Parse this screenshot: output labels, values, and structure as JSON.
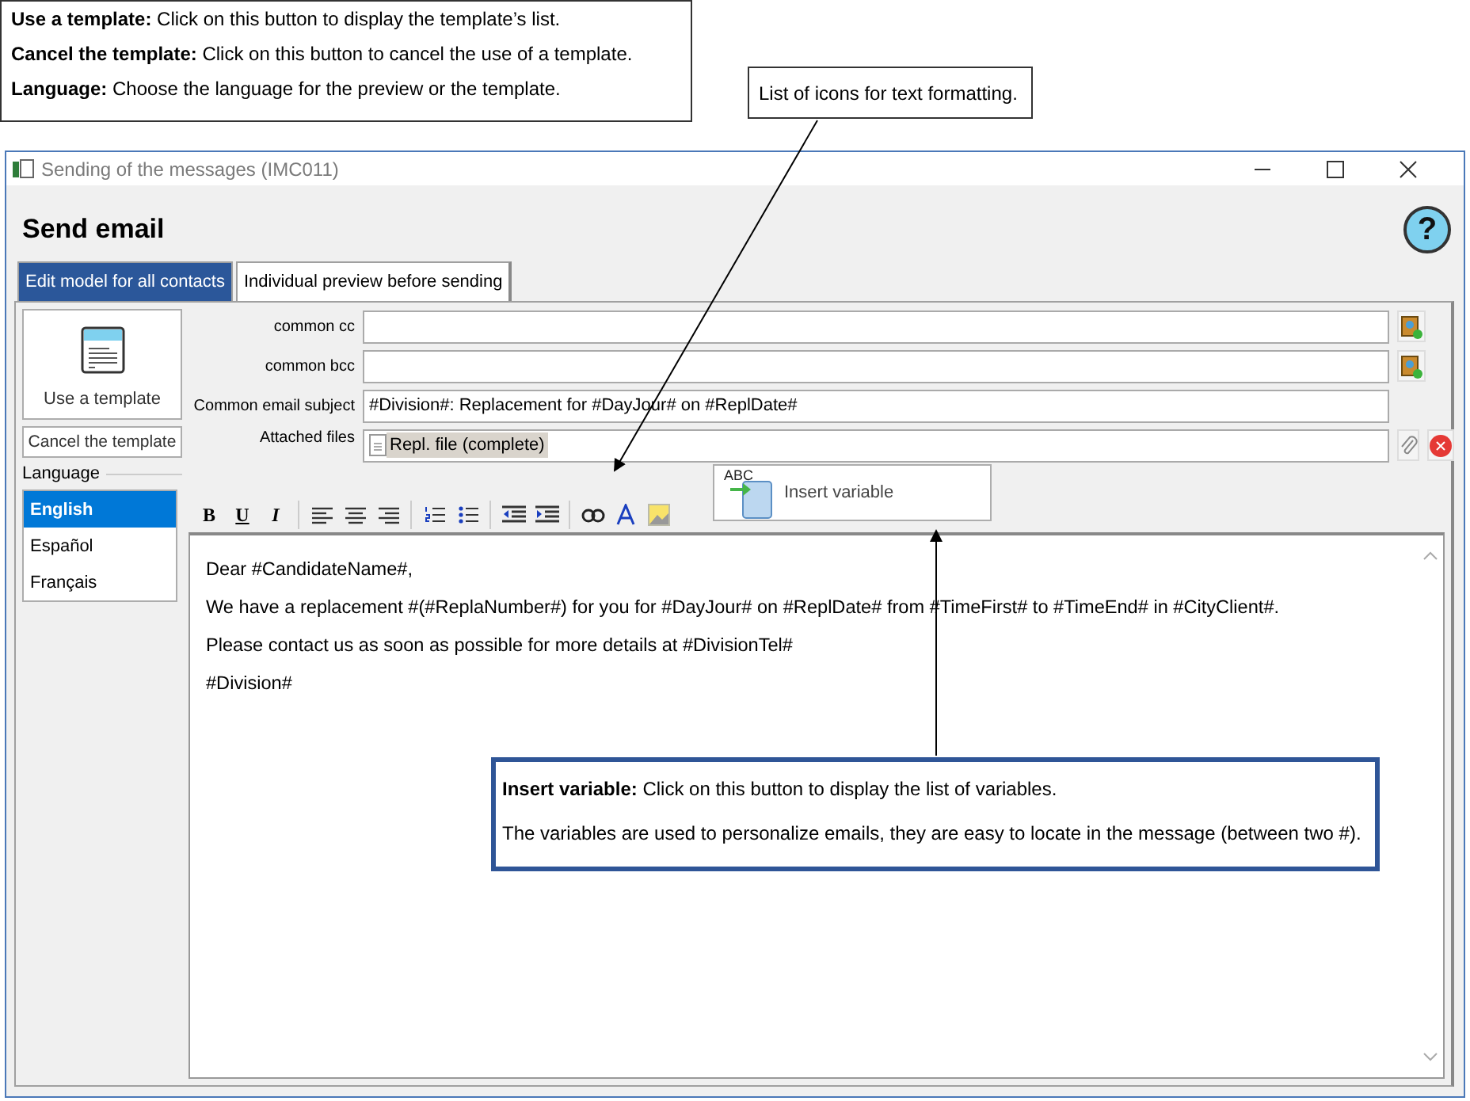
{
  "callouts": [
    {
      "kind": "list",
      "lines": [
        "**Use a template:** Click on this button to display the template’s list.",
        "**Cancel the template:** Click on this button to cancel the use of a template.",
        "**Language:** Choose the language for the preview or the template."
      ]
    },
    {
      "kind": "plain",
      "lines": [
        "List of icons for text formatting."
      ]
    },
    {
      "kind": "framed",
      "lines": [
        "**Insert variable:** Click on this button to display the list of variables.",
        "The variables are used to personalize emails, they are easy to locate in the message (between two #)."
      ]
    }
  ],
  "window": {
    "title": "Sending of the messages (IMC011)",
    "heading": "Send email",
    "help": "?"
  },
  "tabs": [
    {
      "label": "Edit model for all contacts",
      "selected": true
    },
    {
      "label": "Individual preview before sending",
      "selected": false
    }
  ],
  "template_buttons": [
    "Use a template",
    "Cancel the template"
  ],
  "language": {
    "label": "Language",
    "items": [
      {
        "label": "English",
        "selected": true
      },
      {
        "label": "Español",
        "selected": false
      },
      {
        "label": "Français",
        "selected": false
      }
    ]
  },
  "fields": [
    {
      "kind": "address",
      "label": "common cc"
    },
    {
      "kind": "address",
      "label": "common bcc"
    },
    {
      "kind": "text",
      "label": "Common email subject",
      "value": "#Division#: Replacement for #DayJour# on #ReplDate#"
    },
    {
      "kind": "attachment",
      "label": "Attached files",
      "value": "Repl. file (complete)"
    }
  ],
  "format_letters": [
    "B",
    "U",
    "I"
  ],
  "insert_variable": {
    "badge": "ABC",
    "label": "Insert variable"
  },
  "message": [
    "Dear #CandidateName#,",
    "We have a replacement #(#ReplaNumber#) for you for #DayJour# on #ReplDate# from #TimeFirst# to #TimeEnd# in #CityClient#.",
    "Please contact us as soon as possible for more details at #DivisionTel#",
    "#Division#"
  ]
}
